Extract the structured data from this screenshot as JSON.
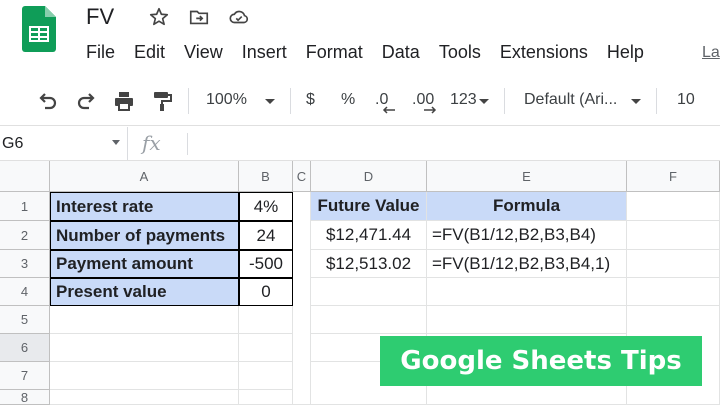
{
  "document": {
    "title": "FV",
    "menu": [
      "File",
      "Edit",
      "View",
      "Insert",
      "Format",
      "Data",
      "Tools",
      "Extensions",
      "Help"
    ],
    "last_edit_label": "La"
  },
  "toolbar": {
    "zoom": "100%",
    "currency": "$",
    "percent": "%",
    "decrease_decimal": ".0",
    "increase_decimal": ".00",
    "more_formats": "123",
    "font": "Default (Ari...",
    "font_size": "10"
  },
  "formula_bar": {
    "name_box": "G6",
    "fx_label": "fx",
    "formula": ""
  },
  "grid": {
    "columns": [
      "A",
      "B",
      "C",
      "D",
      "E",
      "F"
    ],
    "rows": [
      "1",
      "2",
      "3",
      "4",
      "5",
      "6",
      "7",
      "8"
    ],
    "cells": {
      "A1": "Interest rate",
      "A2": "Number of payments",
      "A3": "Payment amount",
      "A4": "Present value",
      "B1": "4%",
      "B2": "24",
      "B3": "-500",
      "B4": "0",
      "D1": "Future Value",
      "E1": "Formula",
      "D2": "$12,471.44",
      "E2": "=FV(B1/12,B2,B3,B4)",
      "D3": "$12,513.02",
      "E3": "=FV(B1/12,B2,B3,B4,1)"
    }
  },
  "banner": {
    "text": "Google Sheets Tips",
    "color": "#2ecc71"
  },
  "colors": {
    "header_blue": "#c9daf8",
    "sheets_green": "#0f9d58"
  }
}
